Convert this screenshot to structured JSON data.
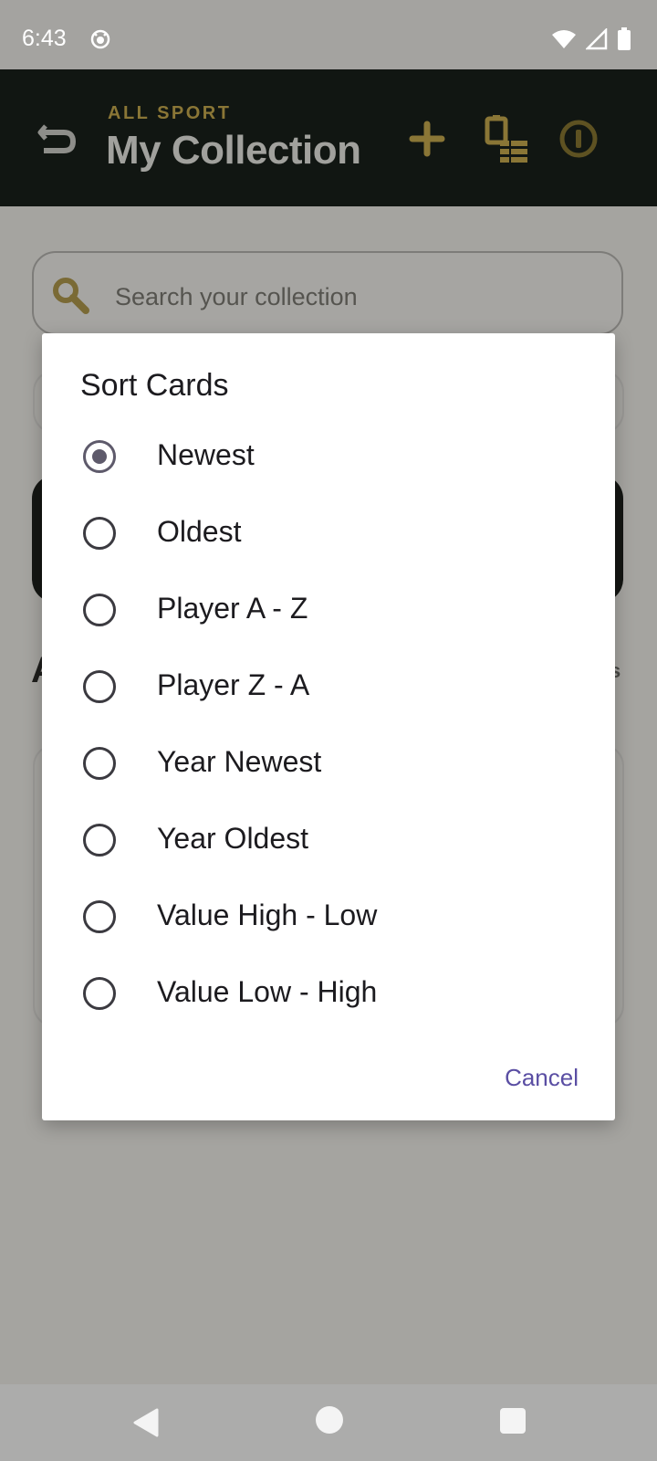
{
  "status_bar": {
    "time": "6:43",
    "icons": [
      "cat-icon",
      "wifi-icon",
      "signal-icon",
      "battery-icon"
    ]
  },
  "app_bar": {
    "subtitle": "ALL SPORT",
    "title": "My Collection",
    "icons": [
      "back-icon",
      "add-icon",
      "manage-collection-icon",
      "info-icon"
    ],
    "accent_color": "#8a7636"
  },
  "search": {
    "placeholder": "Search your collection",
    "value": ""
  },
  "dialog": {
    "title": "Sort Cards",
    "selected": "Newest",
    "options": [
      {
        "label": "Newest",
        "checked": true
      },
      {
        "label": "Oldest",
        "checked": false
      },
      {
        "label": "Player A - Z",
        "checked": false
      },
      {
        "label": "Player Z - A",
        "checked": false
      },
      {
        "label": "Year Newest",
        "checked": false
      },
      {
        "label": "Year Oldest",
        "checked": false
      },
      {
        "label": "Value High - Low",
        "checked": false
      },
      {
        "label": "Value Low - High",
        "checked": false
      }
    ],
    "cancel_label": "Cancel",
    "cancel_color": "#5a4ea3"
  },
  "nav_bar": {
    "icons": [
      "nav-back-icon",
      "nav-home-icon",
      "nav-recents-icon"
    ]
  }
}
